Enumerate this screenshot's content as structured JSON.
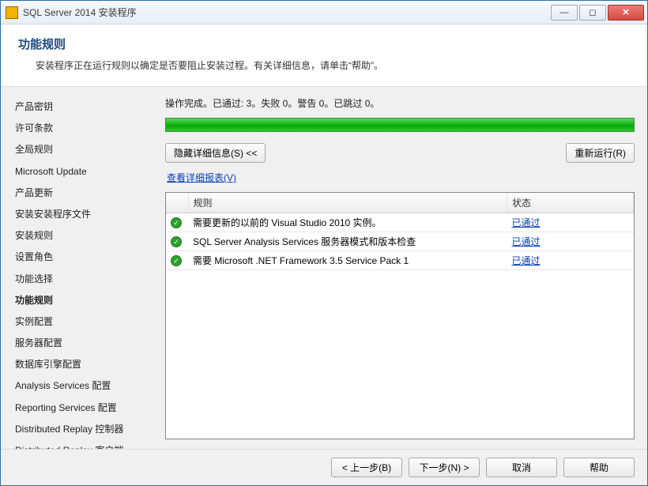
{
  "window": {
    "title": "SQL Server 2014 安装程序"
  },
  "header": {
    "title": "功能规则",
    "subtitle": "安装程序正在运行规则以确定是否要阻止安装过程。有关详细信息，请单击“帮助”。"
  },
  "sidebar": {
    "items": [
      "产品密钥",
      "许可条款",
      "全局规则",
      "Microsoft Update",
      "产品更新",
      "安装安装程序文件",
      "安装规则",
      "设置角色",
      "功能选择",
      "功能规则",
      "实例配置",
      "服务器配置",
      "数据库引擎配置",
      "Analysis Services 配置",
      "Reporting Services 配置",
      "Distributed Replay 控制器",
      "Distributed Replay 客户端"
    ],
    "active_index": 9
  },
  "content": {
    "status_line": "操作完成。已通过: 3。失败 0。警告 0。已跳过 0。",
    "hide_details_label": "隐藏详细信息(S) <<",
    "rerun_label": "重新运行(R)",
    "view_report_label": "查看详细报表(V)",
    "columns": {
      "rule": "规则",
      "status": "状态"
    },
    "rules": [
      {
        "name": "需要更新的以前的 Visual Studio 2010 实例。",
        "status": "已通过"
      },
      {
        "name": "SQL Server Analysis Services 服务器模式和版本检查",
        "status": "已通过"
      },
      {
        "name": "需要 Microsoft .NET Framework 3.5 Service Pack 1",
        "status": "已通过"
      }
    ]
  },
  "footer": {
    "back": "< 上一步(B)",
    "next": "下一步(N) >",
    "cancel": "取消",
    "help": "帮助"
  }
}
